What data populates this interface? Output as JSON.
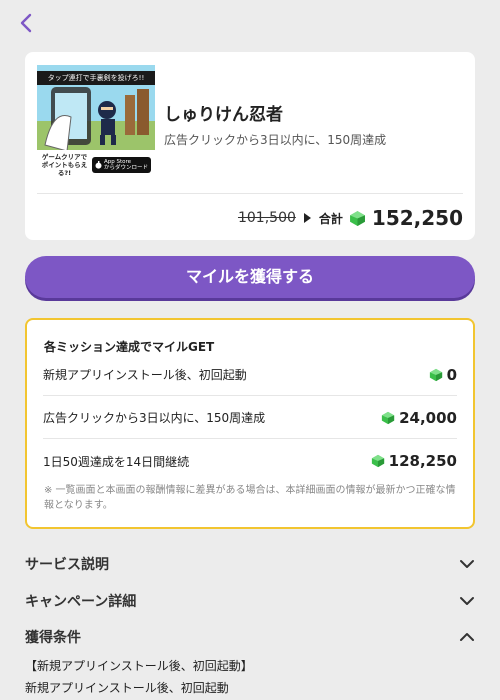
{
  "nav": {
    "back_icon": "chevron-left-icon"
  },
  "app": {
    "name": "しゅりけん忍者",
    "description": "広告クリックから3日以内に、150周達成",
    "thumbnail": {
      "banner_text": "タップ連打で手裏剣を投げろ!!",
      "tagline": "ゲームクリアで ポイントもらえる?!",
      "store_badge_line1": "App Store",
      "store_badge_line2": "からダウンロード"
    }
  },
  "price": {
    "old": "101,500",
    "total_label": "合計",
    "total": "152,250"
  },
  "cta": {
    "label": "マイルを獲得する"
  },
  "missions": {
    "title": "各ミッション達成でマイルGET",
    "rows": [
      {
        "label": "新規アプリインストール後、初回起動",
        "value": "0"
      },
      {
        "label": "広告クリックから3日以内に、150周達成",
        "value": "24,000"
      },
      {
        "label": "1日50週達成を14日間継続",
        "value": "128,250"
      }
    ],
    "note": "※ 一覧画面と本画面の報酬情報に差異がある場合は、本詳細画面の情報が最新かつ正確な情報となります。"
  },
  "sections": [
    {
      "title": "サービス説明",
      "state": "collapsed"
    },
    {
      "title": "キャンペーン詳細",
      "state": "collapsed"
    },
    {
      "title": "獲得条件",
      "state": "expanded"
    }
  ],
  "conditions": {
    "heading": "【新規アプリインストール後、初回起動】",
    "line1": "新規アプリインストール後、初回起動"
  },
  "colors": {
    "background": "#ececec",
    "accent": "#7d57c5",
    "mission_border": "#f2c530",
    "gem": "#3bbf4a"
  }
}
